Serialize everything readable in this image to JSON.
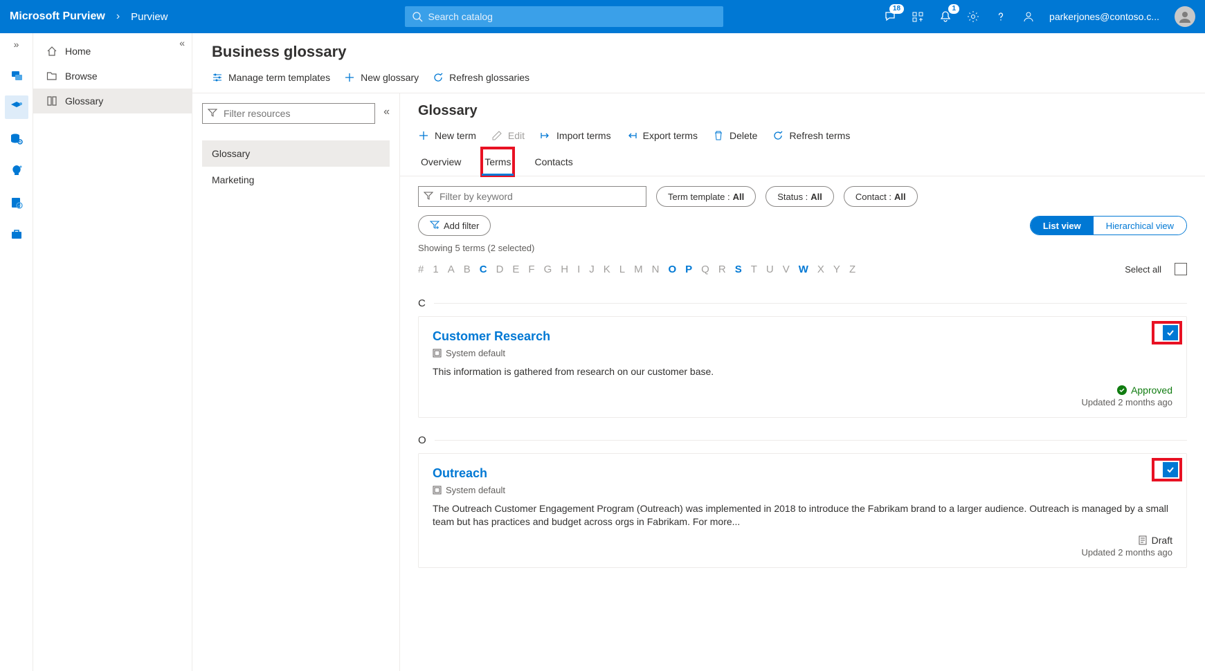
{
  "header": {
    "brand": "Microsoft Purview",
    "breadcrumb": "Purview",
    "search_placeholder": "Search catalog",
    "feedback_badge": "18",
    "notification_badge": "1",
    "user_email": "parkerjones@contoso.c..."
  },
  "rail": {
    "collapse": "»"
  },
  "sidebar": {
    "collapse": "«",
    "items": [
      {
        "label": "Home"
      },
      {
        "label": "Browse"
      },
      {
        "label": "Glossary"
      }
    ]
  },
  "page": {
    "title": "Business glossary",
    "toolbar": [
      {
        "label": "Manage term templates"
      },
      {
        "label": "New glossary"
      },
      {
        "label": "Refresh glossaries"
      }
    ]
  },
  "tree": {
    "filter_placeholder": "Filter resources",
    "collapse": "«",
    "items": [
      {
        "label": "Glossary"
      },
      {
        "label": "Marketing"
      }
    ]
  },
  "main": {
    "title": "Glossary",
    "toolbar": [
      {
        "label": "New term"
      },
      {
        "label": "Edit"
      },
      {
        "label": "Import terms"
      },
      {
        "label": "Export terms"
      },
      {
        "label": "Delete"
      },
      {
        "label": "Refresh terms"
      }
    ],
    "tabs": [
      {
        "label": "Overview"
      },
      {
        "label": "Terms"
      },
      {
        "label": "Contacts"
      }
    ],
    "keyword_placeholder": "Filter by keyword",
    "pills": {
      "template": {
        "label": "Term template :",
        "value": "All"
      },
      "status": {
        "label": "Status :",
        "value": "All"
      },
      "contact": {
        "label": "Contact :",
        "value": "All"
      }
    },
    "add_filter": "Add filter",
    "view": {
      "list": "List view",
      "hier": "Hierarchical view"
    },
    "count": "Showing 5 terms (2 selected)",
    "alpha": {
      "hash": "#",
      "one": "1",
      "letters": [
        "A",
        "B",
        "C",
        "D",
        "E",
        "F",
        "G",
        "H",
        "I",
        "J",
        "K",
        "L",
        "M",
        "N",
        "O",
        "P",
        "Q",
        "R",
        "S",
        "T",
        "U",
        "V",
        "W",
        "X",
        "Y",
        "Z"
      ],
      "active": [
        "C",
        "O",
        "P",
        "S",
        "W"
      ],
      "select_all": "Select all"
    },
    "sections": [
      {
        "letter": "C",
        "cards": [
          {
            "title": "Customer Research",
            "template": "System default",
            "desc": "This information is gathered from research on our customer base.",
            "status": "Approved",
            "status_type": "approved",
            "updated": "Updated 2 months ago"
          }
        ]
      },
      {
        "letter": "O",
        "cards": [
          {
            "title": "Outreach",
            "template": "System default",
            "desc": "The Outreach Customer Engagement Program (Outreach) was implemented in 2018 to introduce the Fabrikam brand to a larger audience. Outreach is managed by a small team but has practices and budget across orgs in Fabrikam. For more...",
            "status": "Draft",
            "status_type": "draft",
            "updated": "Updated 2 months ago"
          }
        ]
      }
    ]
  }
}
